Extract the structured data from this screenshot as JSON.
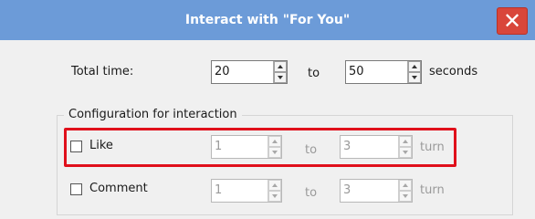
{
  "window": {
    "title": "Interact with \"For You\"",
    "close_glyph": "✕"
  },
  "total_time": {
    "label": "Total time:",
    "from": "20",
    "to_label": "to",
    "to": "50",
    "unit": "seconds"
  },
  "group": {
    "title": "Configuration for interaction",
    "rows": [
      {
        "label": "Like",
        "checked": false,
        "from": "1",
        "to_label": "to",
        "to": "3",
        "unit": "turn"
      },
      {
        "label": "Comment",
        "checked": false,
        "from": "1",
        "to_label": "to",
        "to": "3",
        "unit": "turn"
      }
    ]
  },
  "colors": {
    "titlebar": "#6c9bd8",
    "close": "#d9463a",
    "highlight": "#e0101b"
  },
  "icons": {
    "close": "close-icon",
    "spin_up": "arrow-up-icon",
    "spin_down": "arrow-down-icon"
  }
}
